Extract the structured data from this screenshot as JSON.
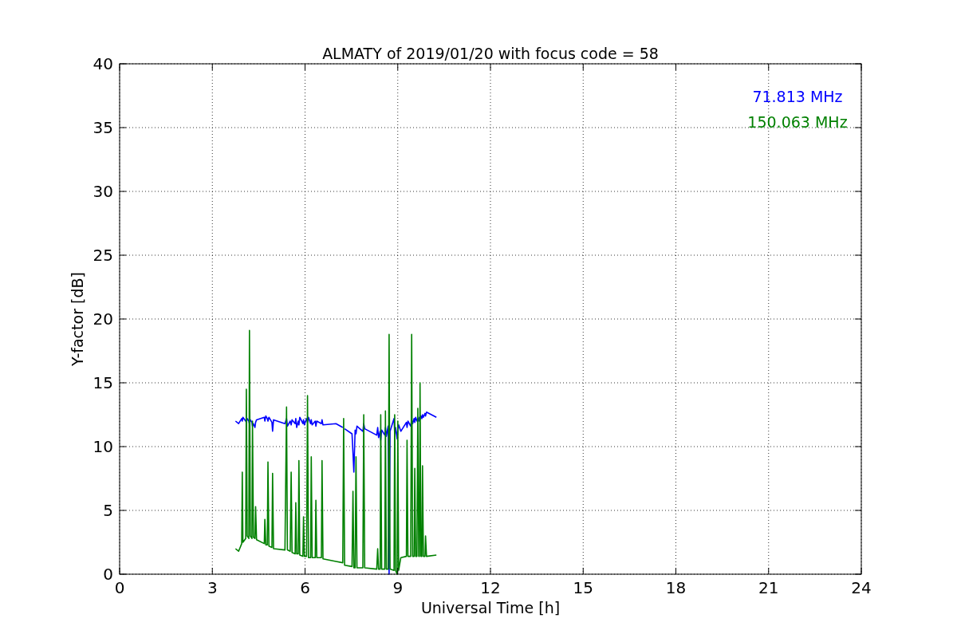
{
  "chart_data": {
    "type": "line",
    "title": "ALMATY of 2019/01/20 with focus code = 58",
    "xlabel": "Universal Time [h]",
    "ylabel": "Y-factor [dB]",
    "x": [
      3.75,
      3.85,
      3.95,
      3.97,
      3.99,
      4.08,
      4.1,
      4.13,
      4.18,
      4.2,
      4.23,
      4.28,
      4.3,
      4.33,
      4.38,
      4.4,
      4.43,
      4.68,
      4.7,
      4.73,
      4.78,
      4.8,
      4.83,
      4.93,
      4.95,
      4.98,
      5.35,
      5.4,
      5.43,
      5.52,
      5.55,
      5.58,
      5.68,
      5.7,
      5.73,
      5.78,
      5.8,
      5.83,
      5.93,
      5.95,
      5.98,
      6.05,
      6.08,
      6.11,
      6.18,
      6.2,
      6.23,
      6.33,
      6.35,
      6.38,
      6.53,
      6.55,
      6.58,
      7,
      7.22,
      7.25,
      7.28,
      7.52,
      7.55,
      7.58,
      7.62,
      7.65,
      7.68,
      7.87,
      7.9,
      7.93,
      8.32,
      8.35,
      8.38,
      8.43,
      8.45,
      8.48,
      8.58,
      8.6,
      8.63,
      8.69,
      8.72,
      8.75,
      8.88,
      8.9,
      8.93,
      8.98,
      9,
      9.03,
      9.1,
      9.28,
      9.3,
      9.33,
      9.42,
      9.45,
      9.48,
      9.53,
      9.55,
      9.58,
      9.62,
      9.65,
      9.68,
      9.7,
      9.72,
      9.75,
      9.78,
      9.8,
      9.83,
      9.88,
      9.9,
      9.93,
      10.25
    ],
    "series": [
      {
        "name": "71.813 MHz",
        "color": "#0000ff",
        "values": [
          12,
          11.8,
          12.2,
          12,
          12.3,
          12,
          11.9,
          12.2,
          12,
          11.8,
          12.1,
          11.9,
          11.6,
          11.8,
          11.5,
          11.9,
          12.1,
          12.3,
          12,
          12.4,
          12.2,
          12,
          12.3,
          11.9,
          11.2,
          12.1,
          11.8,
          12.2,
          11.6,
          12,
          11.7,
          12.1,
          11.8,
          12.2,
          11.5,
          12,
          11.7,
          12.3,
          11.8,
          12.1,
          11.7,
          12.2,
          11.9,
          12.3,
          11.8,
          12.1,
          11.7,
          12,
          11.6,
          12,
          11.8,
          12.1,
          11.7,
          11.8,
          11.5,
          null,
          11.4,
          11,
          9.5,
          8,
          11.3,
          11,
          11.6,
          11.2,
          11.8,
          11.4,
          10.9,
          11.5,
          10.7,
          11.2,
          10.5,
          11.3,
          10.9,
          11.5,
          10.8,
          11.6,
          0,
          11.2,
          12.2,
          11,
          11.5,
          10.6,
          11.3,
          11.7,
          11.2,
          11.9,
          11.5,
          12,
          11.6,
          12.1,
          11.8,
          12.2,
          11.9,
          12.3,
          12,
          12.2,
          12,
          12.3,
          12.1,
          12.4,
          12.2,
          12.5,
          12.3,
          12.6,
          12.4,
          12.7,
          12.3
        ]
      },
      {
        "name": "150.063 MHz",
        "color": "#008000",
        "values": [
          2,
          1.8,
          2.4,
          8,
          2.5,
          2.8,
          14.5,
          3,
          2.8,
          19.1,
          3,
          2.8,
          12,
          2.9,
          2.8,
          5.3,
          2.7,
          2.4,
          4.3,
          2.3,
          2.3,
          8.8,
          2.2,
          2.1,
          7.9,
          2,
          1.9,
          13.1,
          1.9,
          1.8,
          8,
          1.7,
          1.6,
          5.6,
          1.6,
          1.6,
          8.9,
          1.5,
          1.4,
          4.5,
          1.4,
          1.4,
          14,
          1.3,
          1.3,
          9.2,
          1.3,
          1.3,
          5.8,
          1.3,
          1.3,
          8.9,
          1.2,
          1,
          0.9,
          12.2,
          0.7,
          0.6,
          6.5,
          0.5,
          0.5,
          9.2,
          0.5,
          0.5,
          12.5,
          0.5,
          0.4,
          2,
          0.4,
          0.4,
          12.5,
          0.4,
          0.4,
          12.8,
          0.4,
          0.4,
          18.8,
          0.4,
          0.3,
          12.5,
          0.3,
          0,
          12,
          0.3,
          1.3,
          1.4,
          10.5,
          1.4,
          1.4,
          18.8,
          1.4,
          1.4,
          8.3,
          1.4,
          1.4,
          13,
          1.4,
          1.4,
          15,
          1.4,
          1.4,
          8.5,
          1.4,
          1.4,
          3,
          1.4,
          1.5
        ]
      }
    ],
    "grid": true,
    "xlim": [
      0,
      24
    ],
    "ylim": [
      0,
      40
    ],
    "xticks": [
      0,
      3,
      6,
      9,
      12,
      15,
      18,
      21,
      24
    ],
    "yticks": [
      0,
      5,
      10,
      15,
      20,
      25,
      30,
      35,
      40
    ]
  }
}
